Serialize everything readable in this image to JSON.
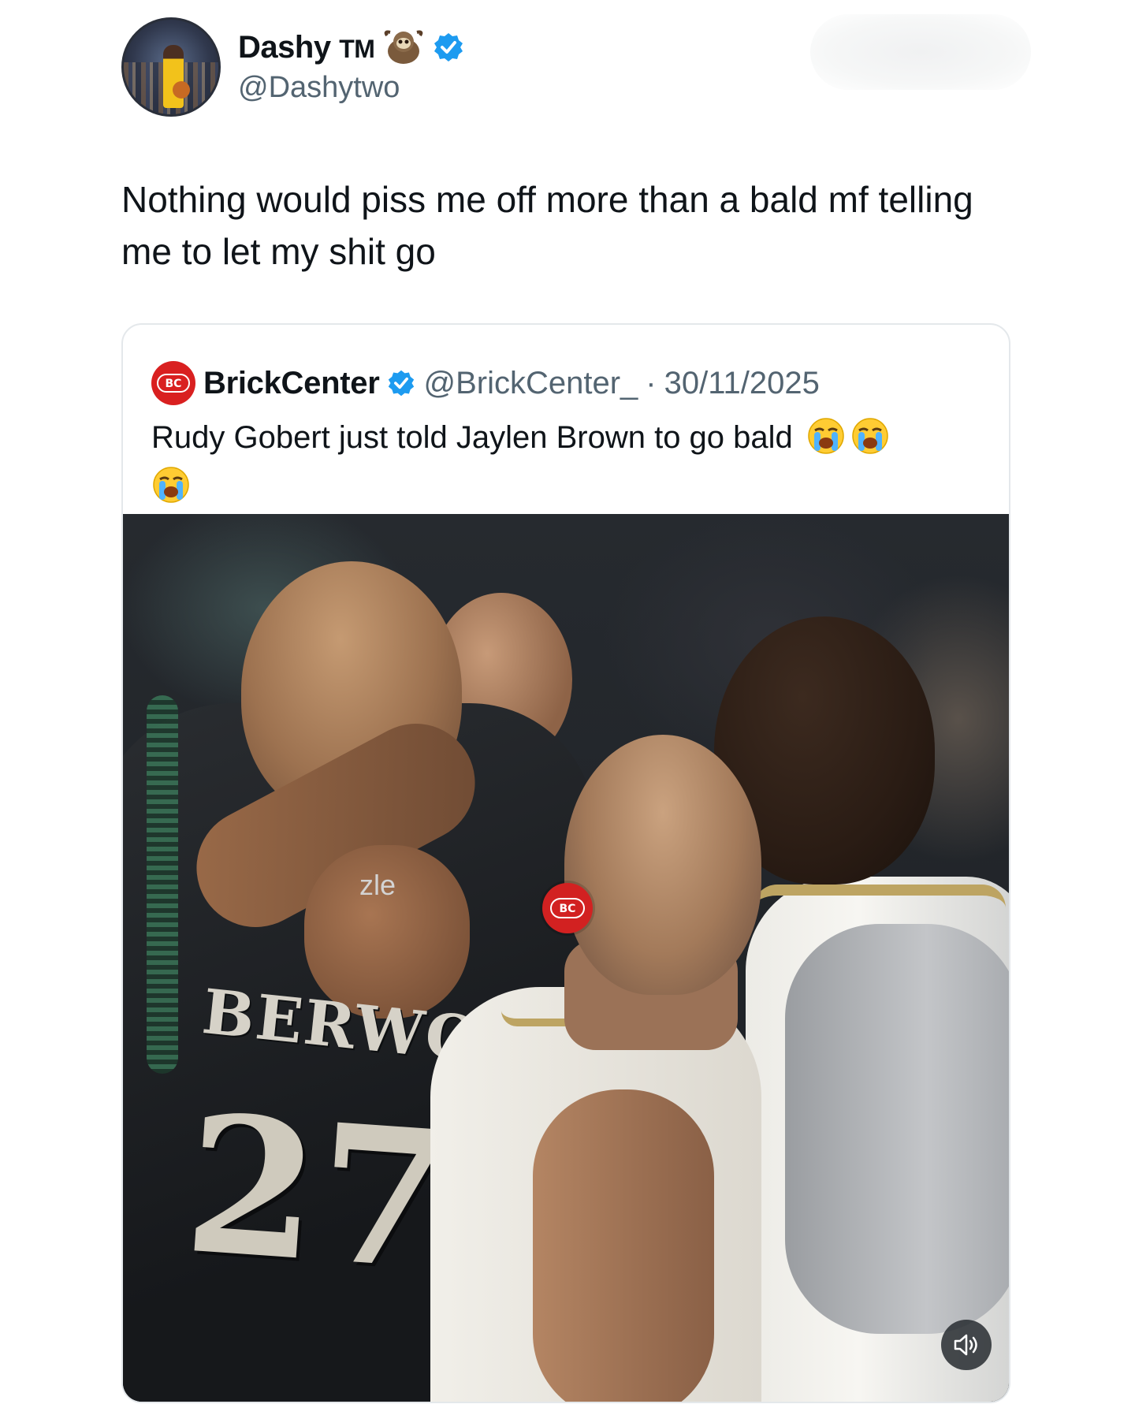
{
  "author": {
    "name": "Dashy",
    "name_suffix": "TM",
    "handle": "@Dashytwo",
    "icons": [
      "avatar",
      "sloth-icon",
      "verified-icon"
    ]
  },
  "tweet": {
    "text": "Nothing would piss me off more than a bald mf telling me to let my shit go"
  },
  "quoted_tweet": {
    "name": "BrickCenter",
    "handle": "@BrickCenter_",
    "separator": "·",
    "date": "30/11/2025",
    "text": "Rudy Gobert just told Jaylen Brown to go bald",
    "emoji_count": 3,
    "logo_text": "BC",
    "media": {
      "jersey_wordmark": "BERWOLV",
      "jersey_number": "27",
      "sponsor_patch": "zle",
      "watermark_text": "BC",
      "volume_icon": "speaker-icon"
    }
  },
  "colors": {
    "verified": "#1d9bf0",
    "brand_red": "#d92020",
    "secondary_text": "#536471"
  }
}
